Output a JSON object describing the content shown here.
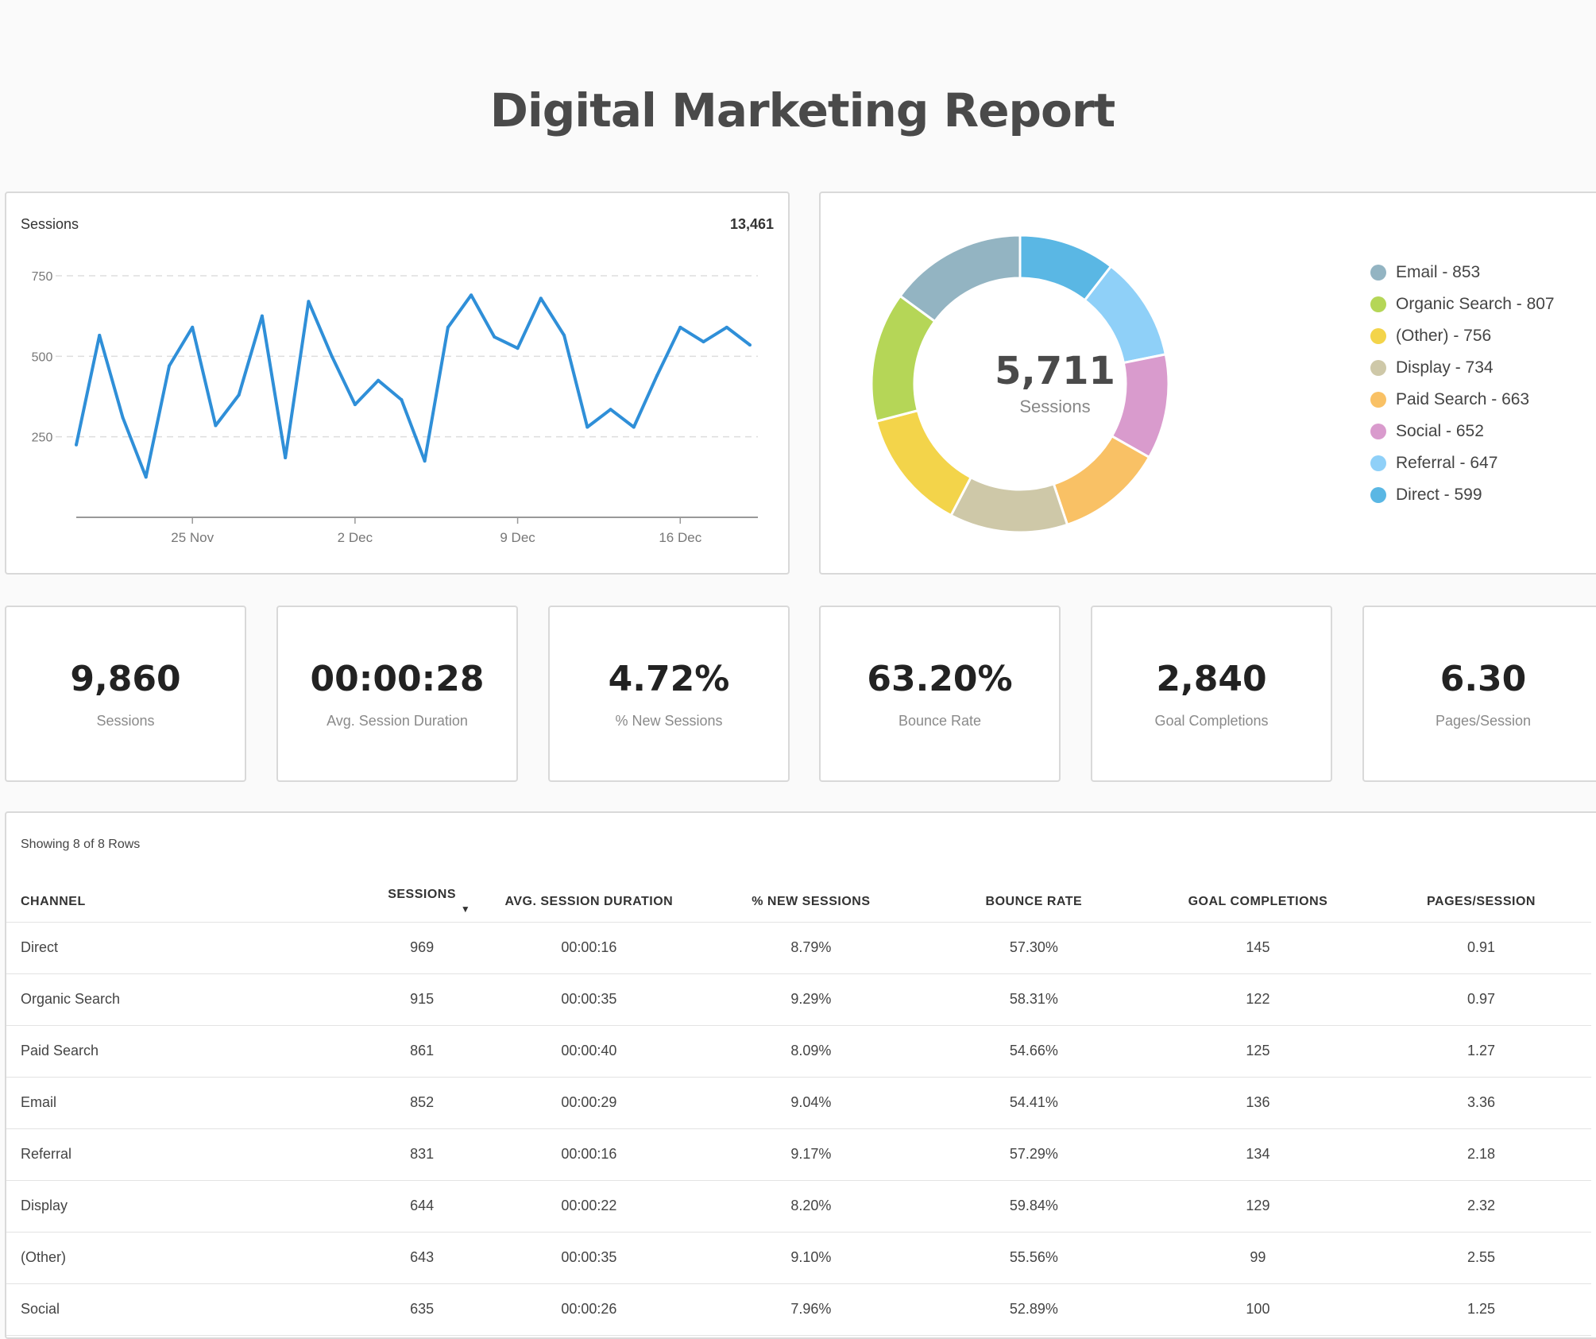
{
  "title": "Digital Marketing Report",
  "sessions_chart": {
    "label": "Sessions",
    "total": "13,461",
    "chart_data": {
      "type": "line",
      "title": "Sessions",
      "y_ticks": [
        "750",
        "500",
        "250"
      ],
      "x_ticks": [
        "25 Nov",
        "2 Dec",
        "9 Dec",
        "16 Dec"
      ],
      "ylim": [
        0,
        750
      ],
      "grid": true,
      "x_start": "2019-11-20",
      "values": [
        225,
        565,
        310,
        125,
        470,
        590,
        285,
        380,
        625,
        185,
        670,
        500,
        350,
        425,
        365,
        175,
        590,
        690,
        560,
        525,
        680,
        565,
        280,
        335,
        280,
        440,
        590,
        545,
        590,
        535
      ]
    }
  },
  "channel_chart": {
    "center_value": "5,711",
    "center_label": "Sessions",
    "legend": [
      {
        "label": "Email - 853",
        "color": "#93b4c2"
      },
      {
        "label": "Organic Search - 807",
        "color": "#b5d657"
      },
      {
        "label": "(Other) - 756",
        "color": "#f3d44a"
      },
      {
        "label": "Display - 734",
        "color": "#cec8a8"
      },
      {
        "label": "Paid Search - 663",
        "color": "#f9c165"
      },
      {
        "label": "Social - 652",
        "color": "#d99bcd"
      },
      {
        "label": "Referral - 647",
        "color": "#8fd0f8"
      },
      {
        "label": "Direct - 599",
        "color": "#5ab7e4"
      }
    ],
    "chart_data": {
      "type": "pie",
      "categories": [
        "Direct",
        "Referral",
        "Social",
        "Paid Search",
        "Display",
        "(Other)",
        "Organic Search",
        "Email"
      ],
      "values": [
        599,
        647,
        652,
        663,
        734,
        756,
        807,
        853
      ],
      "colors": [
        "#5ab7e4",
        "#8fd0f8",
        "#d99bcd",
        "#f9c165",
        "#cec8a8",
        "#f3d44a",
        "#b5d657",
        "#93b4c2"
      ]
    }
  },
  "metrics": [
    {
      "value": "9,860",
      "label": "Sessions"
    },
    {
      "value": "00:00:28",
      "label": "Avg. Session Duration"
    },
    {
      "value": "4.72%",
      "label": "% New Sessions"
    },
    {
      "value": "63.20%",
      "label": "Bounce Rate"
    },
    {
      "value": "2,840",
      "label": "Goal Completions"
    },
    {
      "value": "6.30",
      "label": "Pages/Session"
    }
  ],
  "table": {
    "rows_info": "Showing 8 of 8 Rows",
    "headers": [
      "CHANNEL",
      "SESSIONS",
      "AVG. SESSION DURATION",
      "% NEW SESSIONS",
      "BOUNCE RATE",
      "GOAL COMPLETIONS",
      "PAGES/SESSION"
    ],
    "rows": [
      [
        "Direct",
        "969",
        "00:00:16",
        "8.79%",
        "57.30%",
        "145",
        "0.91"
      ],
      [
        "Organic Search",
        "915",
        "00:00:35",
        "9.29%",
        "58.31%",
        "122",
        "0.97"
      ],
      [
        "Paid Search",
        "861",
        "00:00:40",
        "8.09%",
        "54.66%",
        "125",
        "1.27"
      ],
      [
        "Email",
        "852",
        "00:00:29",
        "9.04%",
        "54.41%",
        "136",
        "3.36"
      ],
      [
        "Referral",
        "831",
        "00:00:16",
        "9.17%",
        "57.29%",
        "134",
        "2.18"
      ],
      [
        "Display",
        "644",
        "00:00:22",
        "8.20%",
        "59.84%",
        "129",
        "2.32"
      ],
      [
        "(Other)",
        "643",
        "00:00:35",
        "9.10%",
        "55.56%",
        "99",
        "2.55"
      ],
      [
        "Social",
        "635",
        "00:00:26",
        "7.96%",
        "52.89%",
        "100",
        "1.25"
      ]
    ]
  }
}
